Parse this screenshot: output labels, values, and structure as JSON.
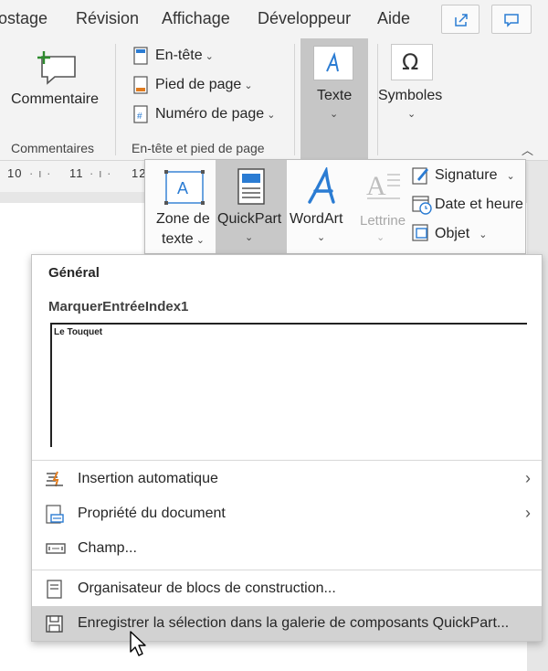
{
  "tabs": [
    "ostage",
    "Révision",
    "Affichage",
    "Développeur",
    "Aide"
  ],
  "top_buttons": {
    "share_icon": "share-icon",
    "comment_icon": "comment-speech-icon"
  },
  "ribbon": {
    "commentaire_label": "Commentaire",
    "commentaires_group": "Commentaires",
    "entete_label": "En-tête",
    "pied_label": "Pied de page",
    "numero_label": "Numéro de page",
    "entete_group": "En-tête et pied de page",
    "texte_label": "Texte",
    "symboles_label": "Symboles",
    "collapse_icon": "chevron-up-icon"
  },
  "ruler": {
    "numbers": [
      "10",
      "11",
      "12"
    ]
  },
  "texte_panel": {
    "zone_label_1": "Zone de",
    "zone_label_2": "texte",
    "quickpart_label": "QuickPart",
    "wordart_label": "WordArt",
    "lettrine_label": "Lettrine",
    "signature_label": "Signature",
    "date_label": "Date et heure",
    "objet_label": "Objet"
  },
  "quickpart_menu": {
    "header": "Général",
    "entry_title": "MarquerEntréeIndex1",
    "preview_text": "Le Touquet",
    "items": [
      {
        "label": "Insertion automatique"
      },
      {
        "label": "Propriété du document"
      },
      {
        "label": "Champ..."
      },
      {
        "label": "Organisateur de blocs de construction..."
      },
      {
        "label": "Enregistrer la sélection dans la galerie de composants QuickPart..."
      }
    ]
  },
  "colors": {
    "accent": "#2b7cd3",
    "selected": "#c8c8c8",
    "hover": "#d2d2d2"
  }
}
